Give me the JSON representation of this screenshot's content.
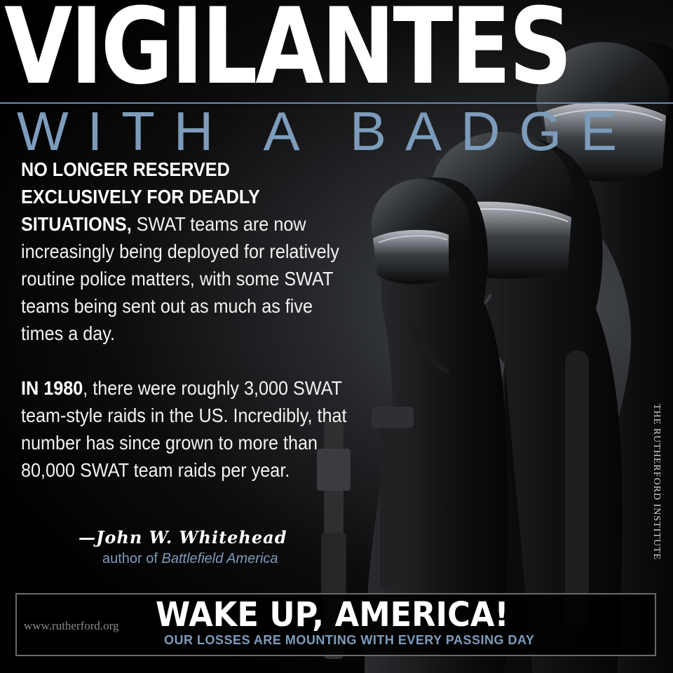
{
  "header": {
    "title": "VIGILANTES",
    "subtitle": "WITH A BADGE"
  },
  "body": {
    "p1_bold": "NO LONGER RESERVED EXCLUSIVELY FOR DEADLY SITUATIONS,",
    "p1_text": "SWAT teams are now increasingly being deployed for relatively routine police matters, with some SWAT teams being sent out as much as five times a day.",
    "p2_bold": "IN 1980",
    "p2_text": ", there were roughly 3,000 SWAT team-style raids in the US. Incredibly, that number has since grown to more than 80,000 SWAT team raids per year."
  },
  "attribution": {
    "signature": "—John W. Whitehead",
    "byline_prefix": "author of",
    "book_title": "Battlefield America"
  },
  "side_text": "THE RUTHERFORD INSTITUTE",
  "footer": {
    "url": "www.rutherford.org",
    "headline": "WAKE UP, AMERICA!",
    "tagline": "OUR LOSSES ARE MOUNTING WITH EVERY PASSING DAY"
  },
  "colors": {
    "accent_blue": "#7d9cbb",
    "text_white": "#ffffff",
    "background": "#000000"
  }
}
